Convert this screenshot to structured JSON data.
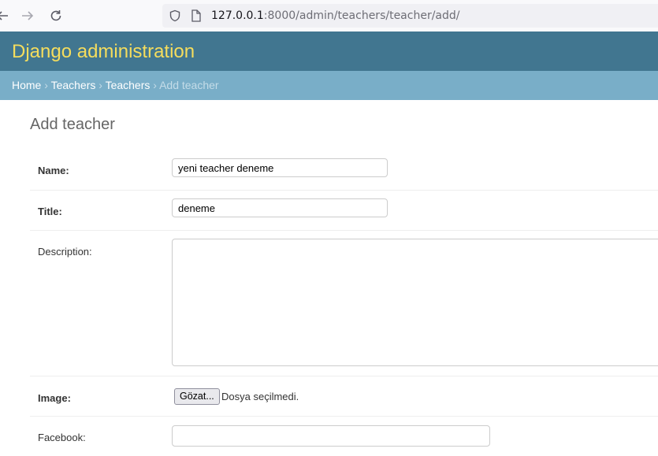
{
  "browser": {
    "url_host": "127.0.0.1",
    "url_rest": ":8000/admin/teachers/teacher/add/"
  },
  "header": {
    "branding": "Django administration"
  },
  "breadcrumbs": {
    "items": [
      "Home",
      "Teachers",
      "Teachers"
    ],
    "separator": "›",
    "current": "Add teacher"
  },
  "page": {
    "title": "Add teacher"
  },
  "form": {
    "name": {
      "label": "Name:",
      "value": "yeni teacher deneme"
    },
    "title": {
      "label": "Title:",
      "value": "deneme"
    },
    "description": {
      "label": "Description:",
      "value": ""
    },
    "image": {
      "label": "Image:",
      "button": "Gözat...",
      "status": "Dosya seçilmedi."
    },
    "facebook": {
      "label": "Facebook:",
      "value": ""
    }
  },
  "colors": {
    "header_bg": "#417690",
    "branding": "#f5dd5d",
    "breadcrumbs_bg": "#79aec8"
  }
}
